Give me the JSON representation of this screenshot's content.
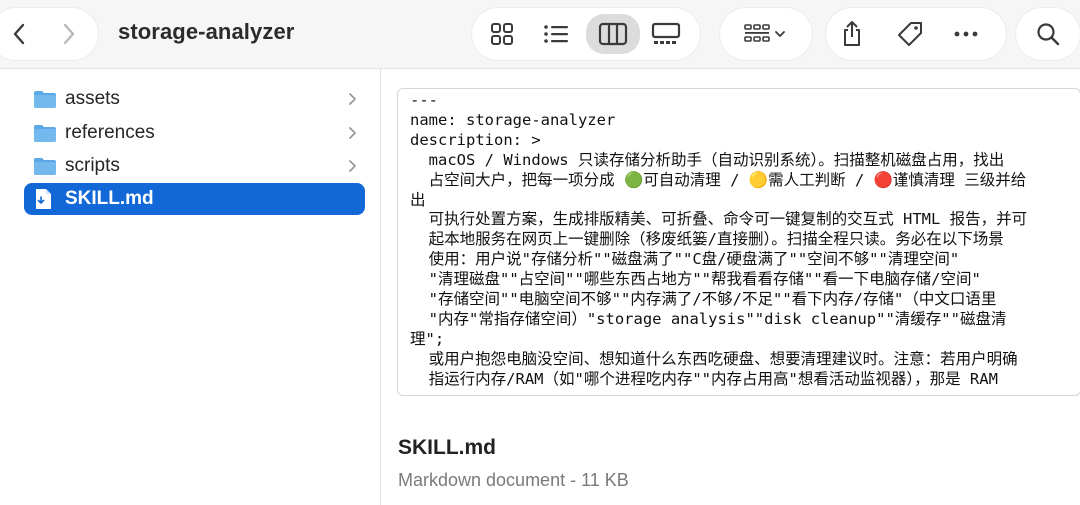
{
  "window": {
    "title": "storage-analyzer"
  },
  "toolbar": {
    "back": "chevron-left",
    "forward": "chevron-right",
    "views": [
      "icon-view",
      "list-view",
      "column-view",
      "gallery-view"
    ],
    "active_view": "column-view",
    "group": "group-menu",
    "actions": [
      "share",
      "tag",
      "more"
    ],
    "search": "search"
  },
  "sidebar": {
    "items": [
      {
        "label": "assets",
        "type": "folder"
      },
      {
        "label": "references",
        "type": "folder"
      },
      {
        "label": "scripts",
        "type": "folder"
      },
      {
        "label": "SKILL.md",
        "type": "file",
        "selected": true
      }
    ]
  },
  "preview": {
    "lines": [
      "---",
      "name: storage-analyzer",
      "description: >",
      "  macOS / Windows 只读存储分析助手（自动识别系统）。扫描整机磁盘占用，找出",
      "  占空间大户，把每一项分成 🟢可自动清理 / 🟡需人工判断 / 🔴谨慎清理 三级并给",
      "出",
      "  可执行处置方案，生成排版精美、可折叠、命令可一键复制的交互式 HTML 报告，并可",
      "  起本地服务在网页上一键删除（移废纸篓/直接删）。扫描全程只读。务必在以下场景",
      "  使用：用户说\"存储分析\"\"磁盘满了\"\"C盘/硬盘满了\"\"空间不够\"\"清理空间\"",
      "  \"清理磁盘\"\"占空间\"\"哪些东西占地方\"\"帮我看看存储\"\"看一下电脑存储/空间\"",
      "  \"存储空间\"\"电脑空间不够\"\"内存满了/不够/不足\"\"看下内存/存储\"（中文口语里",
      "  \"内存\"常指存储空间）\"storage analysis\"\"disk cleanup\"\"清缓存\"\"磁盘清",
      "理\";",
      "  或用户抱怨电脑没空间、想知道什么东西吃硬盘、想要清理建议时。注意：若用户明确",
      "  指运行内存/RAM（如\"哪个进程吃内存\"\"内存占用高\"想看活动监视器），那是 RAM"
    ],
    "file_name": "SKILL.md",
    "file_meta": "Markdown document - 11 KB"
  },
  "colors": {
    "selection": "#1368d8",
    "folder": "#5aa9e6",
    "toolbar_bg": "#f6f6f6"
  }
}
